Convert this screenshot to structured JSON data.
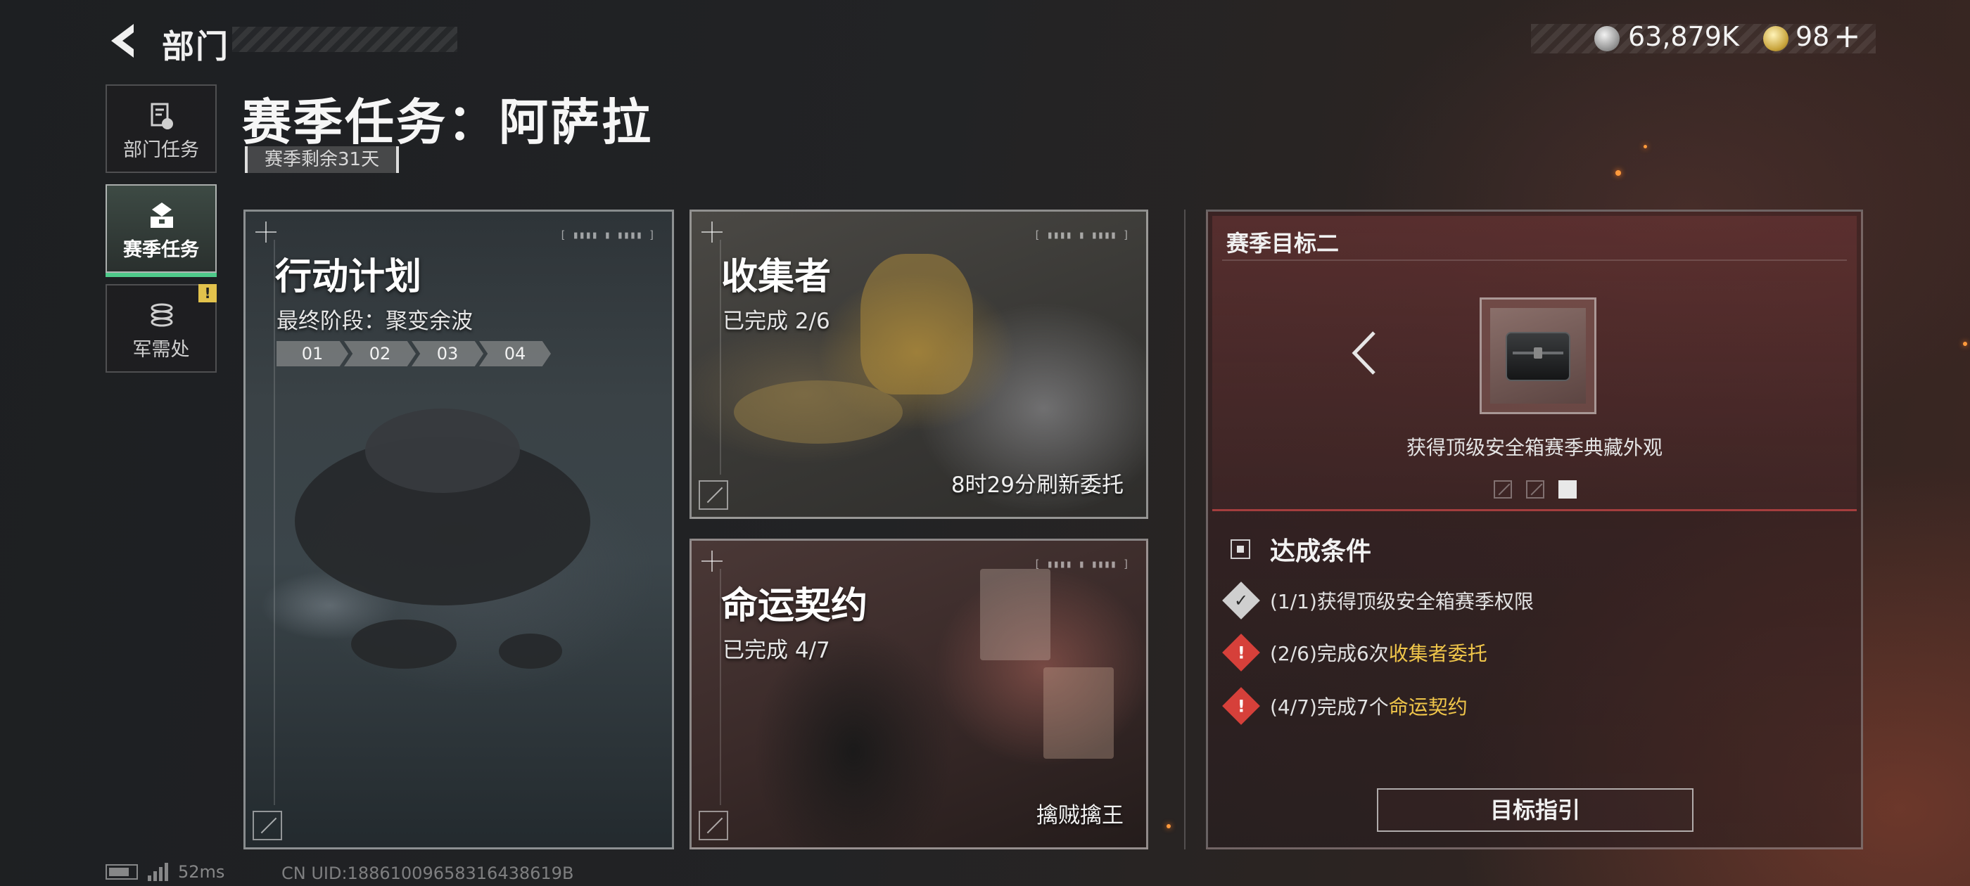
{
  "topbar": {
    "title": "部门"
  },
  "currency": {
    "silver": "63,879K",
    "gold": "98",
    "plus": "+"
  },
  "sidebar": {
    "items": [
      {
        "label": "部门任务",
        "icon": "document-icon"
      },
      {
        "label": "赛季任务",
        "icon": "briefcase-icon",
        "active": true
      },
      {
        "label": "军需处",
        "icon": "coins-icon",
        "badge": "!"
      }
    ]
  },
  "header": {
    "title": "赛季任务：阿萨拉",
    "remaining": "赛季剩余31天"
  },
  "cards": {
    "plan": {
      "title": "行动计划",
      "subtitle": "最终阶段：聚变余波",
      "stages": [
        "01",
        "02",
        "03",
        "04"
      ]
    },
    "collector": {
      "title": "收集者",
      "subtitle": "已完成 2/6",
      "footer": "8时29分刷新委托"
    },
    "fate": {
      "title": "命运契约",
      "subtitle": "已完成 4/7",
      "footer": "擒贼擒王"
    }
  },
  "goal": {
    "title": "赛季目标二",
    "reward": "获得顶级安全箱赛季典藏外观",
    "conditions_title": "达成条件",
    "conditions": [
      {
        "progress": "(1/1)",
        "text": "获得顶级安全箱赛季权限",
        "highlight": "",
        "status": "done"
      },
      {
        "progress": "(2/6)",
        "text": "完成6次",
        "highlight": "收集者委托",
        "status": "pending"
      },
      {
        "progress": "(4/7)",
        "text": "完成7个",
        "highlight": "命运契约",
        "status": "pending"
      }
    ],
    "guide_button": "目标指引",
    "page_count": 3,
    "active_page": 3
  },
  "status": {
    "latency": "52ms",
    "uid": "CN UID:18861009658316438619B"
  },
  "colors": {
    "accent_green": "#4fc98a",
    "warn_red": "#d6403a",
    "highlight_gold": "#f0c64a"
  }
}
